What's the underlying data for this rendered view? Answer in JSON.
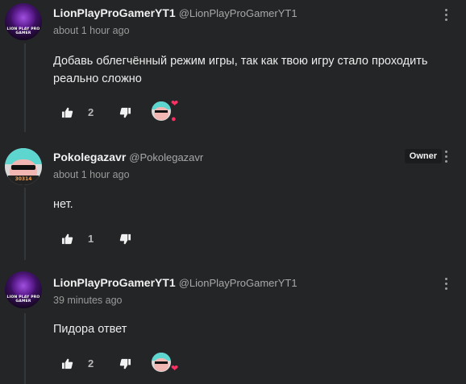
{
  "colors": {
    "background": "#232527",
    "heart": "#ff2e63",
    "owner_badge_bg": "#1b1c1e"
  },
  "comments": [
    {
      "author": "LionPlayProGamerYT1",
      "handle": "@LionPlayProGamerYT1",
      "timestamp": "about 1 hour ago",
      "avatar_text": "LION PLAY PRO GAMER",
      "text": "Добавь облегчённый режим игры, так как твою игру стало проходить реально сложно",
      "likes": "2",
      "hearted": true,
      "reply_bubble": true
    },
    {
      "author": "Pokolegazavr",
      "handle": "@Pokolegazavr",
      "badge": "Owner",
      "timestamp": "about 1 hour ago",
      "avatar_text": "30314",
      "text": "нет.",
      "likes": "1",
      "hearted": false
    },
    {
      "author": "LionPlayProGamerYT1",
      "handle": "@LionPlayProGamerYT1",
      "timestamp": "39 minutes ago",
      "avatar_text": "LION PLAY PRO GAMER",
      "text": "Пидора ответ",
      "likes": "2",
      "hearted": true
    }
  ],
  "icons": {
    "like": "thumbs-up-icon",
    "dislike": "thumbs-down-icon",
    "menu": "more-vertical-icon",
    "heart": "heart-icon"
  }
}
